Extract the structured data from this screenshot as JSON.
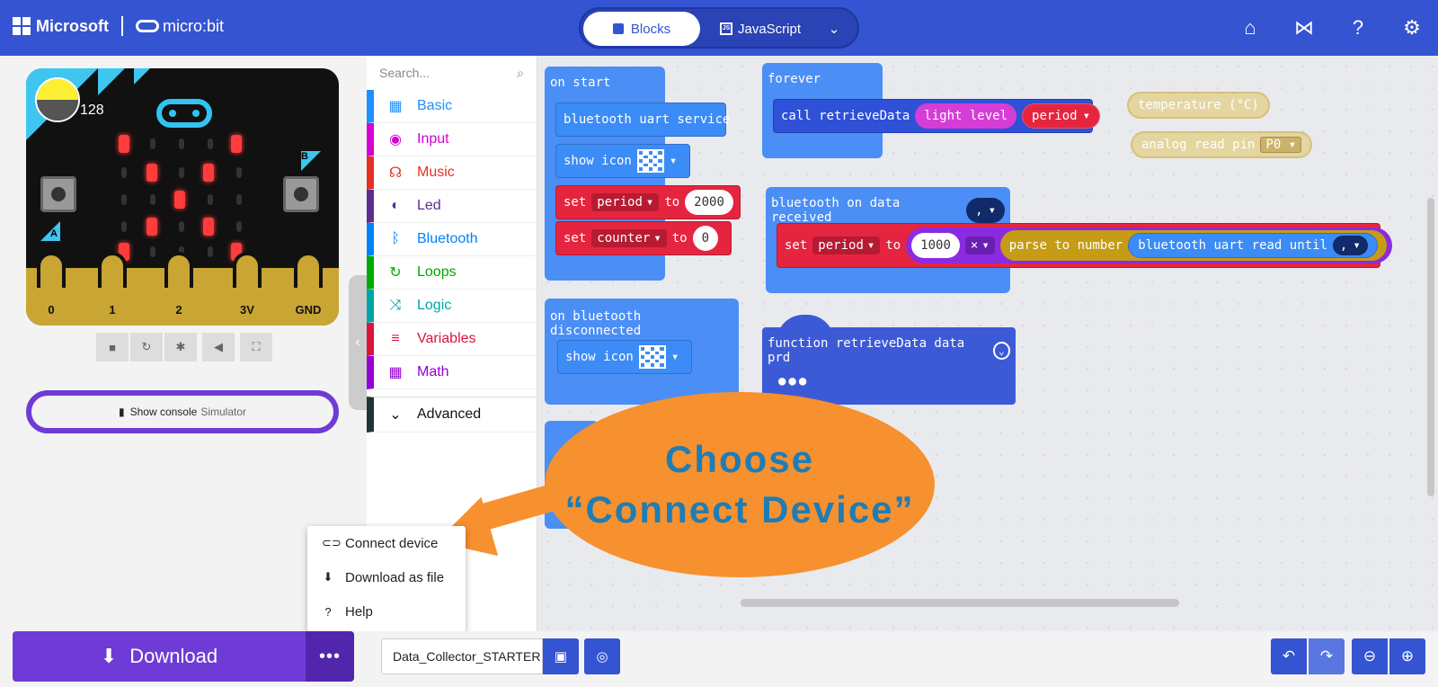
{
  "header": {
    "brand": "Microsoft",
    "product": "micro:bit",
    "tab_blocks": "Blocks",
    "tab_js": "JavaScript",
    "tab_js_icon_text": "JS",
    "icons": [
      "home-icon",
      "share-icon",
      "help-icon",
      "settings-icon"
    ],
    "color": "#3454d1"
  },
  "simulator": {
    "light_level": "128",
    "button_a": "A",
    "button_b": "B",
    "pins": [
      "0",
      "1",
      "2",
      "3V",
      "GND"
    ],
    "controls": [
      "stop-icon",
      "restart-icon",
      "debug-icon",
      "mute-icon",
      "fullscreen-icon"
    ],
    "console_label": "Show console",
    "console_sub": "Simulator"
  },
  "toolbox": {
    "search_placeholder": "Search...",
    "categories": [
      {
        "label": "Basic",
        "color": "#1e90ff"
      },
      {
        "label": "Input",
        "color": "#d400d4"
      },
      {
        "label": "Music",
        "color": "#e63022"
      },
      {
        "label": "Led",
        "color": "#5c2d91"
      },
      {
        "label": "Bluetooth",
        "color": "#0082fb"
      },
      {
        "label": "Loops",
        "color": "#00aa00"
      },
      {
        "label": "Logic",
        "color": "#00a4a6"
      },
      {
        "label": "Variables",
        "color": "#dc143c"
      },
      {
        "label": "Math",
        "color": "#9400d3"
      }
    ],
    "advanced": "Advanced"
  },
  "workspace": {
    "on_start": "on start",
    "bt_uart_service": "bluetooth uart service",
    "show_icon": "show icon",
    "set": "set",
    "to": "to",
    "period": "period",
    "period_value": "2000",
    "counter": "counter",
    "counter_value": "0",
    "forever": "forever",
    "call_retrieve": "call retrieveData",
    "light_level": "light level",
    "temperature": "temperature (°C)",
    "analog_read_pin": "analog read pin",
    "pin_p0": "P0",
    "on_data_received": "bluetooth on data received",
    "delimiter": ",",
    "multiplier": "1000",
    "times": "×",
    "parse_to_number": "parse to number",
    "uart_read_until": "bluetooth uart read until",
    "on_disconnected": "on bluetooth disconnected",
    "function_def": "function retrieveData data prd"
  },
  "callout": {
    "line1": "Choose",
    "line2": "“Connect Device”",
    "color": "#f7902f"
  },
  "menu": {
    "items": [
      {
        "label": "Connect device",
        "icon": "usb-icon"
      },
      {
        "label": "Download as file",
        "icon": "file-download-icon"
      },
      {
        "label": "Help",
        "icon": "help-icon"
      }
    ]
  },
  "footer": {
    "download_label": "Download",
    "more_label": "•••",
    "project_name": "Data_Collector_STARTER"
  }
}
